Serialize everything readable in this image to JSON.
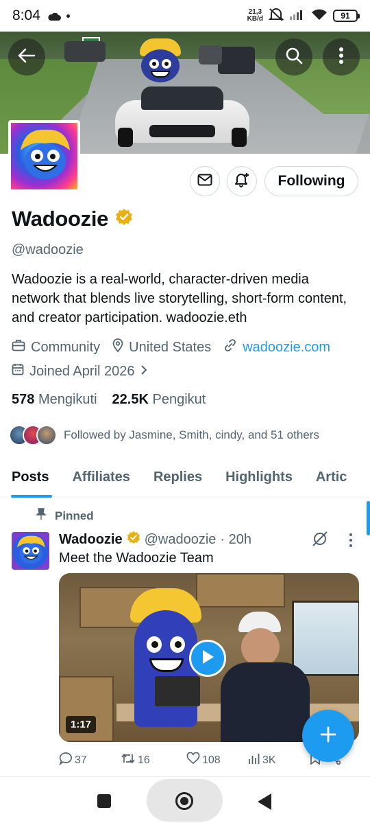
{
  "status_bar": {
    "time": "8:04",
    "net_speed_value": "21,3",
    "net_speed_unit": "KB/d",
    "battery": "91"
  },
  "profile": {
    "display_name": "Wadoozie",
    "handle": "@wadoozie",
    "verified": true,
    "bio": "Wadoozie is a real-world, character-driven media network that blends live storytelling, short-form content, and creator participation. wadoozie.eth",
    "category": "Community",
    "location": "United States",
    "website": "wadoozie.com",
    "joined": "Joined April 2026",
    "following_count": "578",
    "following_label": "Mengikuti",
    "followers_count": "22.5K",
    "followers_label": "Pengikut",
    "followed_by": "Followed by Jasmine, Smith, cindy, and 51 others",
    "follow_button_label": "Following"
  },
  "tabs": [
    {
      "label": "Posts",
      "active": true
    },
    {
      "label": "Affiliates",
      "active": false
    },
    {
      "label": "Replies",
      "active": false
    },
    {
      "label": "Highlights",
      "active": false
    },
    {
      "label": "Artic",
      "active": false
    }
  ],
  "pinned_tweet": {
    "pinned_label": "Pinned",
    "author_name": "Wadoozie",
    "author_handle": "@wadoozie",
    "time": "· 20h",
    "text": "Meet the Wadoozie Team",
    "video_duration": "1:17",
    "replies": "37",
    "reposts": "16",
    "likes": "108",
    "views": "3K"
  },
  "colors": {
    "accent": "#1d9bf0",
    "text_primary": "#0f1419",
    "text_secondary": "#536471",
    "verified_gold": "#e8b012",
    "border": "#cfd9de"
  }
}
